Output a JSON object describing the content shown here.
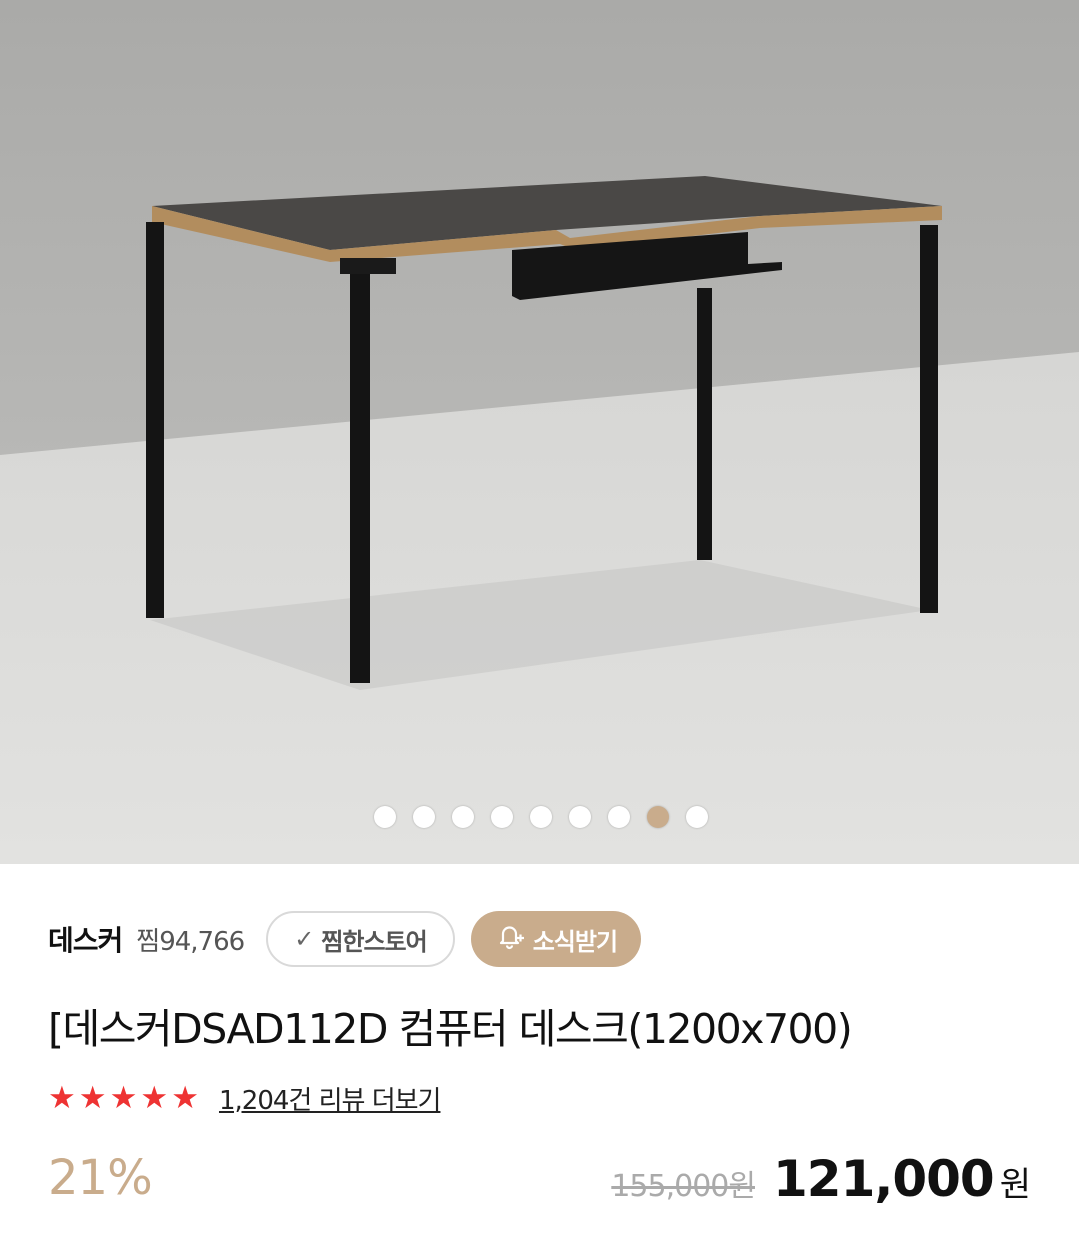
{
  "product": {
    "image_alt": "desk-photo",
    "carousel": {
      "total": 9,
      "active_index": 7
    },
    "store": {
      "name": "데스커",
      "wish_count": "찜94,766",
      "favorite_label": "찜한스토어",
      "news_label": "소식받기"
    },
    "title": "[데스커DSAD112D 컴퓨터 데스크(1200x700)",
    "rating": {
      "stars": 5,
      "review_link": "1,204건 리뷰 더보기"
    },
    "price": {
      "discount": "21%",
      "original": "155,000원",
      "sale": "121,000",
      "currency": "원"
    }
  },
  "colors": {
    "accent": "#c9ac8c",
    "star": "#ee3333"
  },
  "icons": {
    "favorite": "check-icon",
    "news": "bell-plus-icon"
  }
}
